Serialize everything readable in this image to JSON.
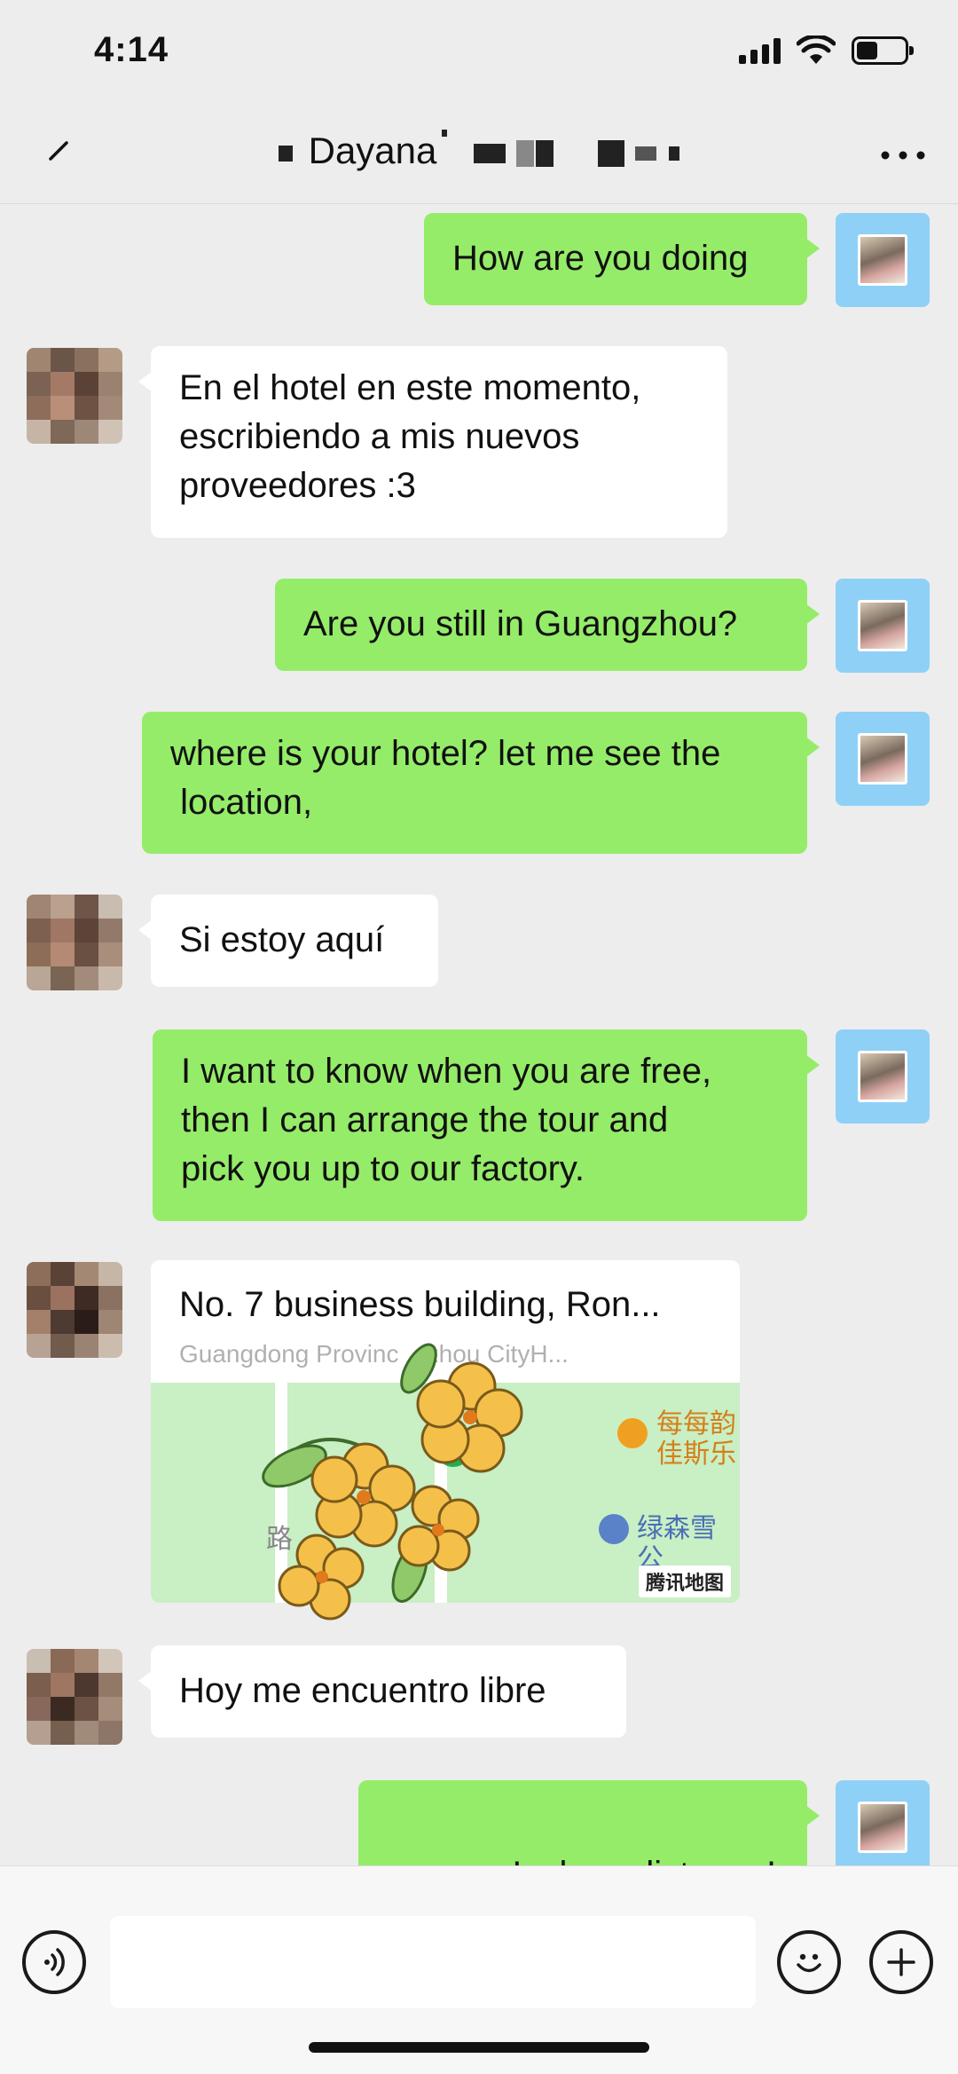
{
  "status_bar": {
    "time": "4:14",
    "signal_icon": "signal-bars-icon",
    "wifi_icon": "wifi-icon",
    "battery_icon": "battery-icon",
    "battery_level": 0.45
  },
  "header": {
    "title": "Dayana",
    "back_icon": "back-arrow-icon",
    "more_icon": "more-dots-icon"
  },
  "messages": [
    {
      "sender": "me",
      "text": "How are you doing"
    },
    {
      "sender": "them",
      "text_lines": [
        "En el hotel en este momento,",
        "escribiendo a mis nuevos",
        "proveedores :3"
      ]
    },
    {
      "sender": "me",
      "text": "Are you still in Guangzhou?"
    },
    {
      "sender": "me",
      "text_lines": [
        "where is your hotel? let me see the",
        " location,"
      ]
    },
    {
      "sender": "them",
      "text": "Si estoy aquí"
    },
    {
      "sender": "me",
      "text_lines": [
        "I want to know when you are free,",
        "then I can arrange the tour and",
        "pick you up to our factory."
      ]
    },
    {
      "sender": "them",
      "type": "location",
      "title": "No. 7 business building, Ron...",
      "subtitle": "Guangdong Provinc    zhou CityH...",
      "map_labels": {
        "poi_1_line1": "每每韵",
        "poi_1_line2": "佳斯乐",
        "poi_2": "绿森雪公",
        "road": "路",
        "brand": "腾讯地图"
      }
    },
    {
      "sender": "them",
      "text": "Hoy me encuentro libre"
    },
    {
      "sender": "me",
      "text": "wao~!  close distance!"
    }
  ],
  "input_bar": {
    "voice_icon": "voice-icon",
    "emoji_icon": "emoji-icon",
    "plus_icon": "plus-icon",
    "placeholder": ""
  },
  "colors": {
    "background": "#ededed",
    "outgoing_bubble": "#95ec69",
    "incoming_bubble": "#ffffff",
    "my_avatar_bg": "#8fd0f7"
  }
}
